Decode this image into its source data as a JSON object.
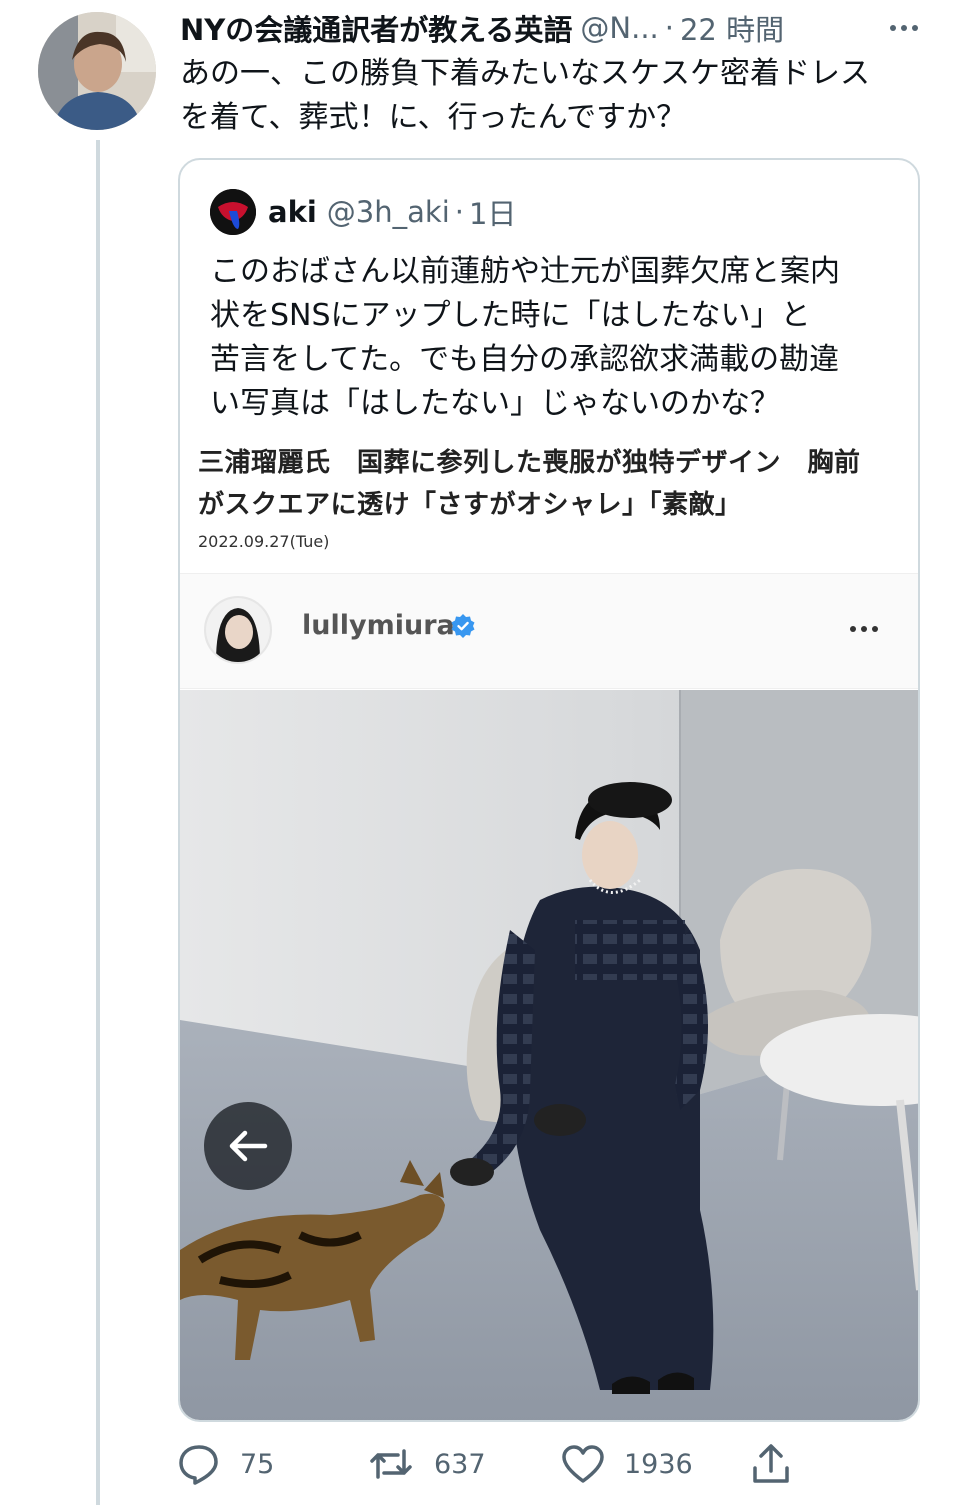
{
  "tweet": {
    "author_name": "NYの会議通訳者が教える英語",
    "author_handle": "@N...",
    "separator": "·",
    "time": "22 時間",
    "text": "あの一、この勝負下着みたいなスケスケ密着ドレス\nを着て、葬式！に、行ったんですか？"
  },
  "quote": {
    "name": "aki",
    "handle": "@3h_aki",
    "separator": "·",
    "time": "1日",
    "text": "このおばさん以前蓮舫や辻元が国葬欠席と案内\n状をSNSにアップした時に「はしたない」と\n苦言をしてた。でも自分の承認欲求満載の勘違\nい写真は「はしたない」じゃないのかな？"
  },
  "article": {
    "headline": "三浦瑠麗氏　国葬に参列した喪服が独特デザイン　胸前\nがスクエアに透け「さすがオシャレ」「素敵」",
    "date": "2022.09.27(Tue)"
  },
  "instagram": {
    "username": "lullymiura"
  },
  "actions": {
    "replies": "75",
    "retweets": "637",
    "likes": "1936"
  },
  "colors": {
    "text_primary": "#0f1419",
    "text_secondary": "#536471",
    "border": "#cfd9de",
    "verified": "#3897f0"
  }
}
